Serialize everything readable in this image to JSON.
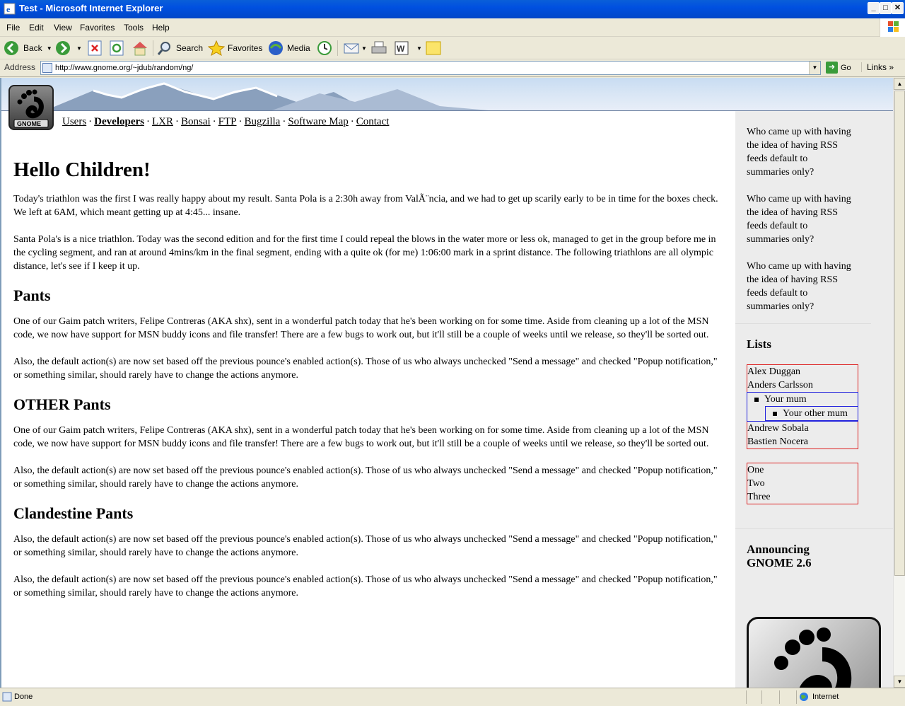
{
  "window": {
    "title": "Test - Microsoft Internet Explorer",
    "buttons": {
      "minimize": "_",
      "maximize": "□",
      "close": "✕"
    }
  },
  "menu": [
    "File",
    "Edit",
    "View",
    "Favorites",
    "Tools",
    "Help"
  ],
  "toolbar": {
    "back": "Back",
    "search": "Search",
    "favorites": "Favorites",
    "media": "Media"
  },
  "address": {
    "label": "Address",
    "url": "http://www.gnome.org/~jdub/random/ng/",
    "go": "Go",
    "links": "Links"
  },
  "page": {
    "logo_text": "GNOME",
    "nav": [
      "Users",
      "Developers",
      "LXR",
      "Bonsai",
      "FTP",
      "Bugzilla",
      "Software Map",
      "Contact"
    ],
    "nav_separator": "·",
    "heading": "Hello Children!",
    "paragraphs_intro": [
      "Today's triathlon was the first I was really happy about my result. Santa Pola is a 2:30h away from ValÃ¨ncia, and we had to get up scarily early to be in time for the boxes check. We left at 6AM, which meant getting up at 4:45... insane.",
      "Santa Pola's is a nice triathlon. Today was the second edition and for the first time I could repeal the blows in the water more or less ok, managed to get in the group before me in the cycling segment, and ran at around 4mins/km in the final segment, ending with a quite ok (for me) 1:06:00 mark in a sprint distance. The following triathlons are all olympic distance, let's see if I keep it up."
    ],
    "sections": [
      {
        "title": "Pants",
        "paragraphs": [
          "One of our Gaim patch writers, Felipe Contreras (AKA shx), sent in a wonderful patch today that he's been working on for some time. Aside from cleaning up a lot of the MSN code, we now have support for MSN buddy icons and file transfer! There are a few bugs to work out, but it'll still be a couple of weeks until we release, so they'll be sorted out.",
          "Also, the default action(s) are now set based off the previous pounce's enabled action(s). Those of us who always unchecked \"Send a message\" and checked \"Popup notification,\" or something similar, should rarely have to change the actions anymore."
        ]
      },
      {
        "title": "OTHER Pants",
        "paragraphs": [
          "One of our Gaim patch writers, Felipe Contreras (AKA shx), sent in a wonderful patch today that he's been working on for some time. Aside from cleaning up a lot of the MSN code, we now have support for MSN buddy icons and file transfer! There are a few bugs to work out, but it'll still be a couple of weeks until we release, so they'll be sorted out.",
          "Also, the default action(s) are now set based off the previous pounce's enabled action(s). Those of us who always unchecked \"Send a message\" and checked \"Popup notification,\" or something similar, should rarely have to change the actions anymore."
        ]
      },
      {
        "title": "Clandestine Pants",
        "paragraphs": [
          "Also, the default action(s) are now set based off the previous pounce's enabled action(s). Those of us who always unchecked \"Send a message\" and checked \"Popup notification,\" or something similar, should rarely have to change the actions anymore.",
          "Also, the default action(s) are now set based off the previous pounce's enabled action(s). Those of us who always unchecked \"Send a message\" and checked \"Popup notification,\" or something similar, should rarely have to change the actions anymore."
        ]
      }
    ],
    "sidebar": {
      "questions": [
        "Who came up with having the idea of having RSS feeds default to summaries only?",
        "Who came up with having the idea of having RSS feeds default to summaries only?",
        "Who came up with having the idea of having RSS feeds default to summaries only?"
      ],
      "lists_title": "Lists",
      "people": [
        "Alex Duggan",
        "Anders Carlsson",
        "Your mum",
        "Your other mum",
        "Andrew Sobala",
        "Bastien Nocera"
      ],
      "numbers": [
        "One",
        "Two",
        "Three"
      ],
      "announce_title": "Announcing GNOME 2.6"
    }
  },
  "status": {
    "text": "Done",
    "zone": "Internet"
  },
  "colors": {
    "titlebar": "#0050e0",
    "chrome": "#ece9d8",
    "sidebar": "#ececec",
    "list_border_red": "#dd2222",
    "list_border_blue": "#2222dd"
  }
}
